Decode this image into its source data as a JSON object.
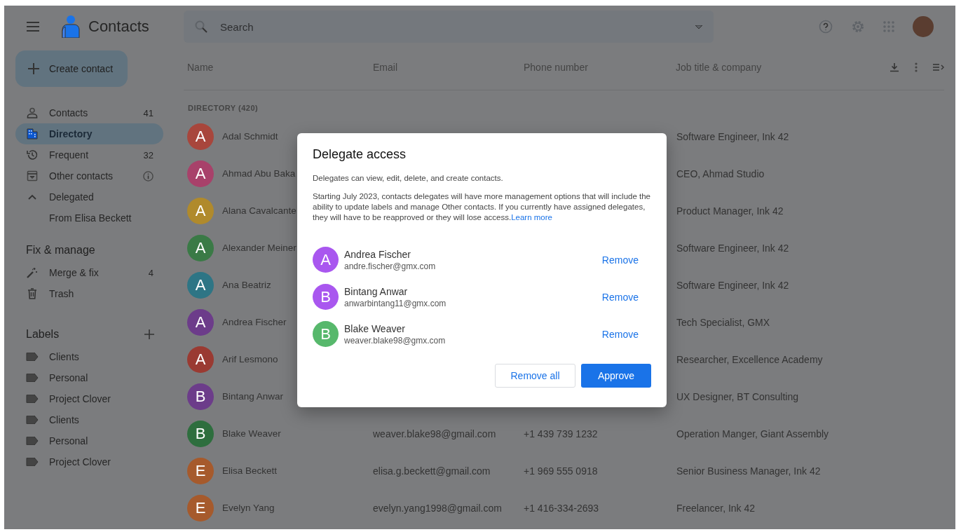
{
  "app": {
    "title": "Contacts"
  },
  "search": {
    "placeholder": "Search"
  },
  "create_button": "Create contact",
  "nav": [
    {
      "label": "Contacts",
      "count": "41",
      "kind": "person",
      "selected": false
    },
    {
      "label": "Directory",
      "kind": "building",
      "selected": true
    },
    {
      "label": "Frequent",
      "count": "32",
      "kind": "history",
      "selected": false
    },
    {
      "label": "Other contacts",
      "kind": "archive",
      "info": true,
      "selected": false
    },
    {
      "label": "Delegated",
      "kind": "caret",
      "expanded": true,
      "selected": false,
      "children": [
        {
          "label": "From Elisa Beckett",
          "selected": false
        }
      ]
    }
  ],
  "fix_manage": {
    "heading": "Fix & manage",
    "items": [
      {
        "label": "Merge & fix",
        "count": "4",
        "kind": "wand"
      },
      {
        "label": "Trash",
        "kind": "trash"
      }
    ]
  },
  "labels": {
    "heading": "Labels",
    "items": [
      "Clients",
      "Personal",
      "Project Clover",
      "Clients",
      "Personal",
      "Project Clover"
    ]
  },
  "table": {
    "columns": [
      "Name",
      "Email",
      "Phone number",
      "Job title & company"
    ],
    "section": "DIRECTORY (420)",
    "rows": [
      {
        "initial": "A",
        "name": "Adal Schmidt",
        "job": "Software Engineer, Ink 42",
        "color": "#a8463c"
      },
      {
        "initial": "A",
        "name": "Ahmad Abu Baka",
        "job": "CEO, Ahmad Studio",
        "color": "#a8416a"
      },
      {
        "initial": "A",
        "name": "Alana Cavalcante",
        "job": "Product Manager, Ink 42",
        "color": "#b08a2c"
      },
      {
        "initial": "A",
        "name": "Alexander Meiner",
        "job": "Software Engineer, Ink 42",
        "color": "#3a7a46"
      },
      {
        "initial": "A",
        "name": "Ana Beatriz",
        "job": "Software Engineer, Ink 42",
        "color": "#2e7585"
      },
      {
        "initial": "A",
        "name": "Andrea Fischer",
        "job": "Tech Specialist, GMX",
        "color": "#6c3c8a"
      },
      {
        "initial": "A",
        "name": "Arif Lesmono",
        "job": "Researcher, Excellence Academy",
        "color": "#9a3a32"
      },
      {
        "initial": "B",
        "name": "Bintang Anwar",
        "job": "UX Designer, BT Consulting",
        "color": "#6c3c8a"
      },
      {
        "initial": "B",
        "name": "Blake Weaver",
        "email": "weaver.blake98@gmail.com",
        "phone": "+1 439 739 1232",
        "job": "Operation Manger, Giant Assembly",
        "color": "#2e6e3e"
      },
      {
        "initial": "E",
        "name": "Elisa Beckett",
        "email": "elisa.g.beckett@gmail.com",
        "phone": "+1 969 555 0918",
        "job": "Senior Business Manager, Ink 42",
        "color": "#a65a2c"
      },
      {
        "initial": "E",
        "name": "Evelyn Yang",
        "email": "evelyn.yang1998@gmail.com",
        "phone": "+1 416-334-2693",
        "job": "Freelancer, Ink 42",
        "color": "#a65a2c"
      }
    ]
  },
  "dialog": {
    "title": "Delegate access",
    "paragraphs": [
      {
        "text": "Delegates can view, edit, delete, and create contacts."
      },
      {
        "text": "Starting July 2023, contacts delegates will have more management options that will include the ability to update labels and manage Other contacts. If you currently have assigned delegates, they will have to be reapproved or they will lose access.",
        "link": "Learn more"
      }
    ],
    "delegates": [
      {
        "initial": "A",
        "name": "Andrea Fischer",
        "email": "andre.fischer@gmx.com",
        "action": "Remove",
        "color": "#a957ef"
      },
      {
        "initial": "B",
        "name": "Bintang Anwar",
        "email": "anwarbintang11@gmx.com",
        "action": "Remove",
        "color": "#a957ef"
      },
      {
        "initial": "B",
        "name": "Blake Weaver",
        "email": "weaver.blake98@gmx.com",
        "action": "Remove",
        "color": "#57b86c"
      }
    ],
    "secondary_button": "Remove all",
    "primary_button": "Approve"
  }
}
